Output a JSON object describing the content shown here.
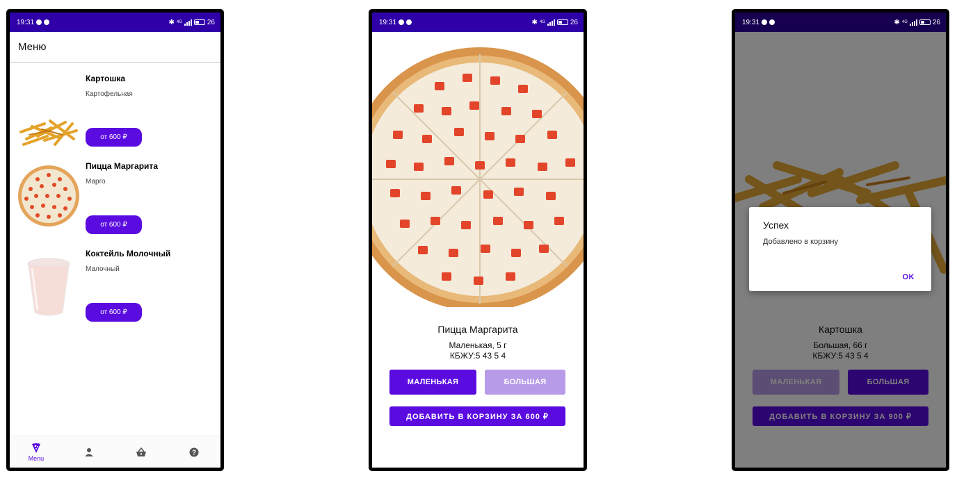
{
  "status": {
    "time": "19:31",
    "network": "4G",
    "battery": "26"
  },
  "menu_screen": {
    "title": "Меню",
    "items": [
      {
        "name": "Картошка",
        "desc": "Картофельная",
        "price": "от 600 ₽"
      },
      {
        "name": "Пицца Маргарита",
        "desc": "Марго",
        "price": "от 600 ₽"
      },
      {
        "name": "Коктейль Молочный",
        "desc": "Малочный",
        "price": "от 600 ₽"
      }
    ],
    "nav": {
      "menu_label": "Menu"
    }
  },
  "detail_screen": {
    "name": "Пицца Маргарита",
    "size_info": "Маленькая, 5 г",
    "kbju": "КБЖУ:5 43 5 4",
    "small_label": "МАЛЕНЬКАЯ",
    "large_label": "БОЛЬШАЯ",
    "add_label": "ДОБАВИТЬ В КОРЗИНУ ЗА 600 ₽"
  },
  "dialog_screen": {
    "name": "Картошка",
    "size_info": "Большая, 66 г",
    "kbju": "КБЖУ:5 43 5 4",
    "small_label": "МАЛЕНЬКАЯ",
    "large_label": "БОЛЬШАЯ",
    "add_label": "ДОБАВИТЬ В КОРЗИНУ ЗА 900 ₽",
    "dialog": {
      "title": "Успех",
      "message": "Добавлено в корзину",
      "ok": "OK"
    }
  },
  "colors": {
    "accent": "#5a0be0",
    "statusbar": "#2f00a8",
    "accent_light": "#b89be8"
  }
}
